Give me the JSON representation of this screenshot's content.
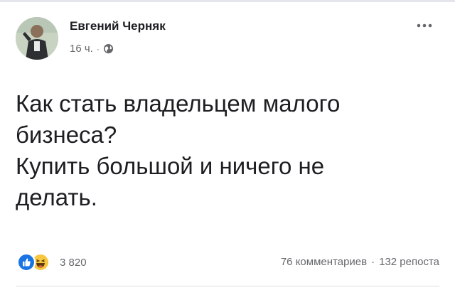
{
  "post": {
    "author": "Евгений Черняк",
    "time": "16 ч.",
    "separator": "·",
    "audience_icon": "globe-icon",
    "menu_icon": "more-dots-icon",
    "text_lines": [
      "Как стать владельцем малого",
      "бизнеса?",
      "Купить большой и ничего не",
      "делать."
    ],
    "reactions": {
      "icons": [
        "like-icon",
        "haha-icon"
      ],
      "count": "3 820"
    },
    "stats": {
      "comments": "76 комментариев",
      "separator": "·",
      "shares": "132 репоста"
    }
  },
  "colors": {
    "like": "#1b74e4",
    "haha": "#f7c83f",
    "secondary_text": "#65676b",
    "primary_text": "#1c1e21"
  }
}
